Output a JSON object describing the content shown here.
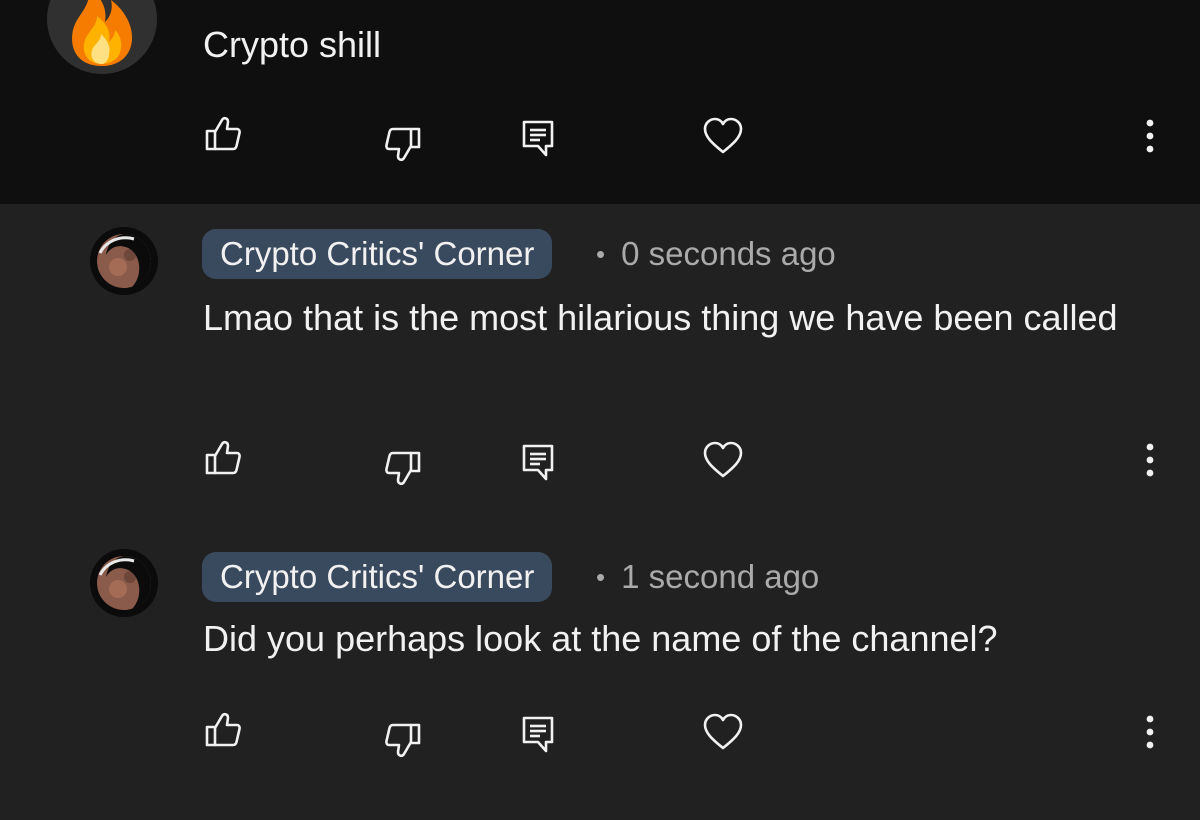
{
  "comments": [
    {
      "text": "Crypto shill",
      "avatar": "fire-emoji-avatar"
    },
    {
      "author": "Crypto Critics' Corner",
      "separator": "•",
      "time": "0 seconds ago",
      "text": "Lmao that is the most hilarious thing we have been called",
      "avatar": "moon-eclipse-avatar"
    },
    {
      "author": "Crypto Critics' Corner",
      "separator": "•",
      "time": "1 second ago",
      "text": "Did you perhaps look at the name of the channel?",
      "avatar": "moon-eclipse-avatar"
    }
  ],
  "actions": {
    "like_icon": "thumbs-up-icon",
    "dislike_icon": "thumbs-down-icon",
    "reply_icon": "reply-icon",
    "heart_icon": "heart-icon",
    "more_icon": "more-vertical-icon"
  },
  "colors": {
    "background": "#212121",
    "top_background": "#0f0f0f",
    "author_chip": "#3a4a5e",
    "secondary_text": "#aaaaaa",
    "primary_text": "#f1f1f1"
  }
}
